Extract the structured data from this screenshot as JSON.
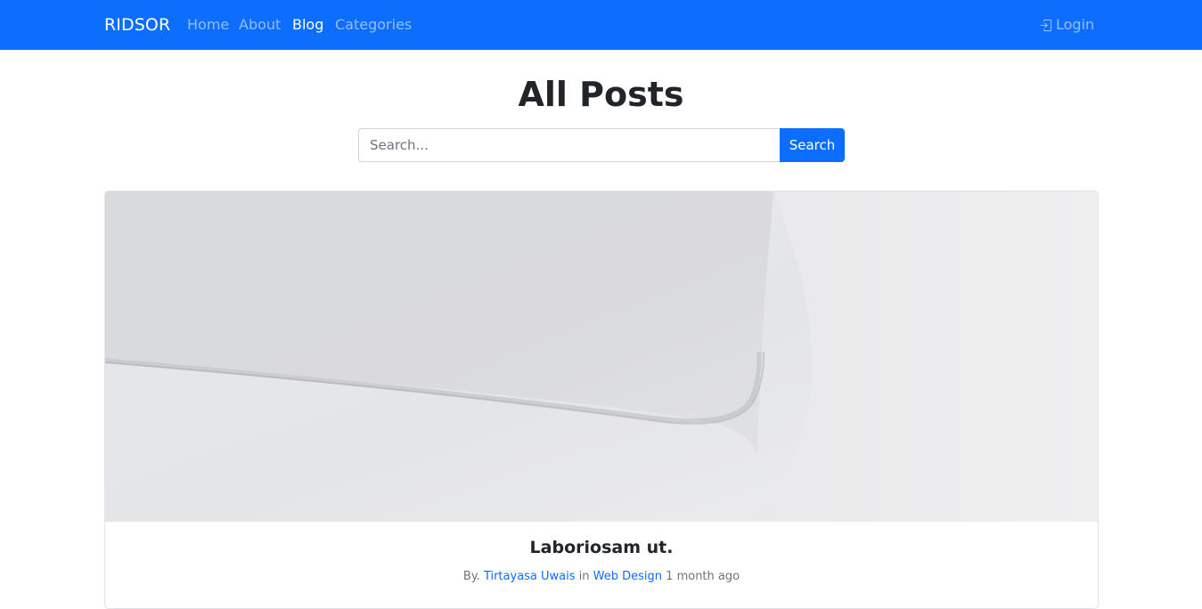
{
  "navbar": {
    "brand": "RIDSOR",
    "links": [
      {
        "label": "Home",
        "active": false
      },
      {
        "label": "About",
        "active": false
      },
      {
        "label": "Blog",
        "active": true
      },
      {
        "label": "Categories",
        "active": false
      }
    ],
    "login_label": "Login",
    "login_icon": "box-arrow-in-right-icon"
  },
  "page": {
    "title": "All Posts"
  },
  "search": {
    "placeholder": "Search...",
    "value": "",
    "button_label": "Search"
  },
  "post": {
    "image_description_icon": "post-cover-image",
    "title": "Laboriosam ut.",
    "meta": {
      "by_prefix": "By.",
      "author": "Tirtayasa Uwais",
      "in_word": "in",
      "category": "Web Design",
      "time_ago": "1 month ago"
    }
  },
  "colors": {
    "primary": "#0d6efd",
    "muted_text": "#6c757d",
    "heading_text": "#212529"
  }
}
